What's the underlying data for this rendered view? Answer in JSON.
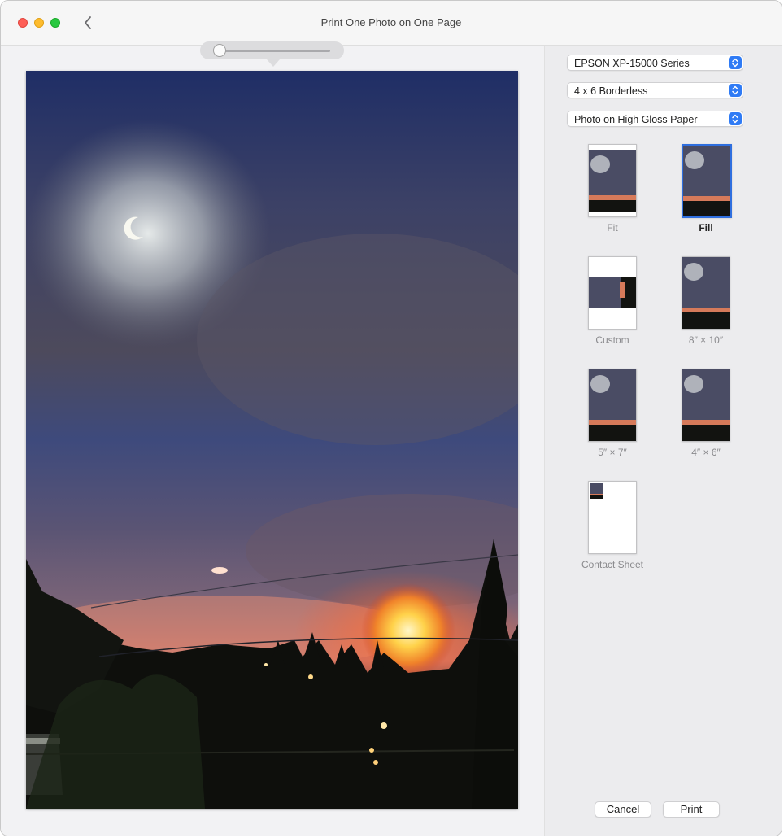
{
  "window": {
    "title": "Print One Photo on One Page"
  },
  "zoom": {
    "level": 0.0
  },
  "printer": {
    "value": "EPSON XP-15000 Series"
  },
  "paper_size": {
    "value": "4 x 6 Borderless"
  },
  "paper_type": {
    "value": "Photo on High Gloss Paper"
  },
  "layout_options": [
    {
      "label": "Fit",
      "selected": false
    },
    {
      "label": "Fill",
      "selected": true
    },
    {
      "label": "Custom",
      "selected": false
    },
    {
      "label": "8″ × 10″",
      "selected": false
    },
    {
      "label": "5″ × 7″",
      "selected": false
    },
    {
      "label": "4″ × 6″",
      "selected": false
    },
    {
      "label": "Contact Sheet",
      "selected": false
    }
  ],
  "actions": {
    "cancel": "Cancel",
    "print": "Print"
  },
  "colors": {
    "accent": "#2f7bf5",
    "selected_border": "#2f6fdf"
  }
}
